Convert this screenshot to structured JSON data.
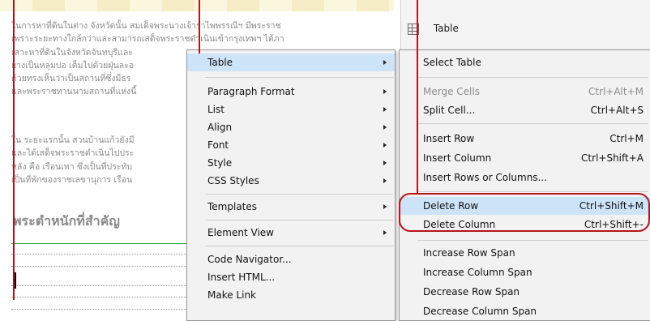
{
  "document": {
    "paragraphs": [
      "ในการหาที่ดินในต่าง จังหวัดนั้น สมเด็จพระนางเจ้ารำไพพรรณีฯ มีพระราช",
      "เพราะระยะทางใกล้กว่าและสามารถเสด็จพระราชดำเนินเข้ากรุงเทพฯ ได้ภา",
      "เสาะหาที่ดินในจังหวัดจันทบุรีและ",
      "ยางเป็นหลุมบ่อ เต็มไปด้วยฝุ่นละอ",
      "ด้วยทรงเห็นว่าเป็นสถานที่ซึ่งมีธร",
      "และพระราชทานนามสถานที่แห่งนี้",
      "ใน ระยะแรกนั้น สวนบ้านแก้วยังมี",
      "และได้เสด็จพระราชดำเนินไปประ",
      "หลัง คือ เรือนเทา ซึ่งเป็นที่ประทับ",
      "เป็นที่พักของราชเลขานุการ เรือน"
    ],
    "heading": "พระตำหนักที่สำคัญ"
  },
  "side_panel": {
    "item_label": "Table",
    "icon": "table-icon"
  },
  "context_menu": {
    "items": [
      {
        "label": "Table",
        "submenu": true,
        "highlighted": true
      },
      {
        "label": "Paragraph Format",
        "submenu": true
      },
      {
        "label": "List",
        "submenu": true
      },
      {
        "label": "Align",
        "submenu": true
      },
      {
        "label": "Font",
        "submenu": true
      },
      {
        "label": "Style",
        "submenu": true
      },
      {
        "label": "CSS Styles",
        "submenu": true
      },
      {
        "label": "Templates",
        "submenu": true
      },
      {
        "label": "Element View",
        "submenu": true
      },
      {
        "label": "Code Navigator..."
      },
      {
        "label": "Insert HTML..."
      },
      {
        "label": "Make Link"
      }
    ]
  },
  "table_submenu": {
    "items": [
      {
        "label": "Select Table",
        "shortcut": ""
      },
      {
        "label": "Merge Cells",
        "shortcut": "Ctrl+Alt+M",
        "disabled": true
      },
      {
        "label": "Split Cell...",
        "shortcut": "Ctrl+Alt+S"
      },
      {
        "label": "Insert Row",
        "shortcut": "Ctrl+M"
      },
      {
        "label": "Insert Column",
        "shortcut": "Ctrl+Shift+A"
      },
      {
        "label": "Insert Rows or Columns...",
        "shortcut": ""
      },
      {
        "label": "Delete Row",
        "shortcut": "Ctrl+Shift+M",
        "highlighted": true
      },
      {
        "label": "Delete Column",
        "shortcut": "Ctrl+Shift+-"
      },
      {
        "label": "Increase Row Span",
        "shortcut": ""
      },
      {
        "label": "Increase Column Span",
        "shortcut": ""
      },
      {
        "label": "Decrease Row Span",
        "shortcut": ""
      },
      {
        "label": "Decrease Column Span",
        "shortcut": ""
      }
    ]
  },
  "colors": {
    "annotation_red": "#b8131b",
    "menu_background": "#f2f2f2",
    "highlight": "#cde3f7",
    "heading_green_rule": "#3aa040"
  }
}
